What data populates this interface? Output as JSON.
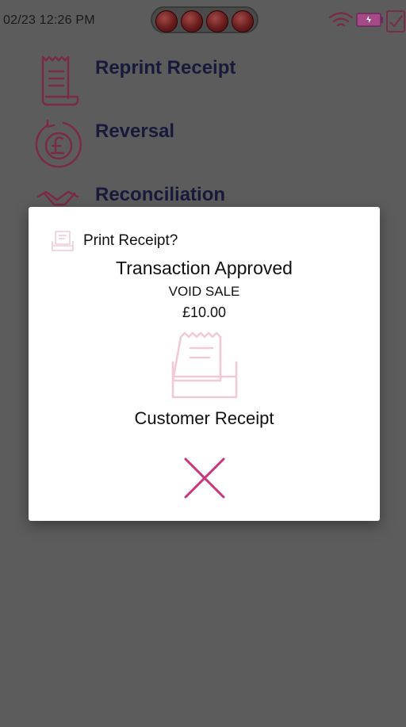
{
  "status_bar": {
    "time": "02/23 12:26 PM",
    "icons": [
      "wifi-icon",
      "battery-icon",
      "task-check-icon"
    ],
    "led_color": "#7a1f1f"
  },
  "menu": {
    "items": [
      {
        "label": "Reprint Receipt",
        "icon": "receipt-icon"
      },
      {
        "label": "Reversal",
        "icon": "pound-reverse-icon"
      },
      {
        "label": "Reconciliation",
        "icon": "handshake-icon"
      }
    ]
  },
  "dialog": {
    "title": "Print Receipt?",
    "status": "Transaction Approved",
    "type": "VOID SALE",
    "amount": "£10.00",
    "receipt_option": "Customer Receipt",
    "icons": {
      "header": "printer-icon",
      "receipt": "receipt-printer-icon",
      "close": "close-icon"
    }
  },
  "colors": {
    "accent": "#c8357c",
    "accent_light": "#f2c9d7",
    "menu_icon": "#7c2847",
    "menu_text": "#181a3c",
    "backdrop": "#5b5c5b"
  }
}
